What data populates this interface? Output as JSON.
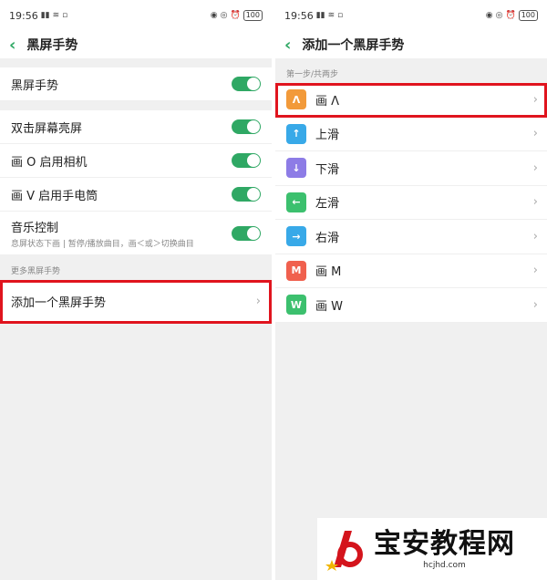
{
  "left": {
    "status": {
      "time": "19:56",
      "battery": "100"
    },
    "header": {
      "title": "黑屏手势"
    },
    "rows_top": [
      {
        "label": "黑屏手势"
      }
    ],
    "rows_mid": [
      {
        "label": "双击屏幕亮屏"
      },
      {
        "label": "画 O 启用相机"
      },
      {
        "label": "画 V 启用手电筒"
      }
    ],
    "music": {
      "label": "音乐控制",
      "sub": "息屏状态下画 | 暂停/播放曲目，画＜或＞切换曲目"
    },
    "more_section": "更多黑屏手势",
    "add_row": {
      "label": "添加一个黑屏手势"
    }
  },
  "right": {
    "status": {
      "time": "19:56",
      "battery": "100"
    },
    "header": {
      "title": "添加一个黑屏手势"
    },
    "step_label": "第一步/共两步",
    "gestures": [
      {
        "label": "画 Λ",
        "glyph": "Λ",
        "color": "#f29a3a"
      },
      {
        "label": "上滑",
        "glyph": "↑",
        "color": "#38a9e8"
      },
      {
        "label": "下滑",
        "glyph": "↓",
        "color": "#8d7ce6"
      },
      {
        "label": "左滑",
        "glyph": "←",
        "color": "#3cc06e"
      },
      {
        "label": "右滑",
        "glyph": "→",
        "color": "#38a9e8"
      },
      {
        "label": "画 M",
        "glyph": "M",
        "color": "#f0604e"
      },
      {
        "label": "画 W",
        "glyph": "W",
        "color": "#3cc06e"
      }
    ]
  },
  "watermark": {
    "title": "宝安教程网",
    "url": "hcjhd.com"
  },
  "colors": {
    "accent": "#2fa864",
    "highlight": "#e0141e"
  }
}
